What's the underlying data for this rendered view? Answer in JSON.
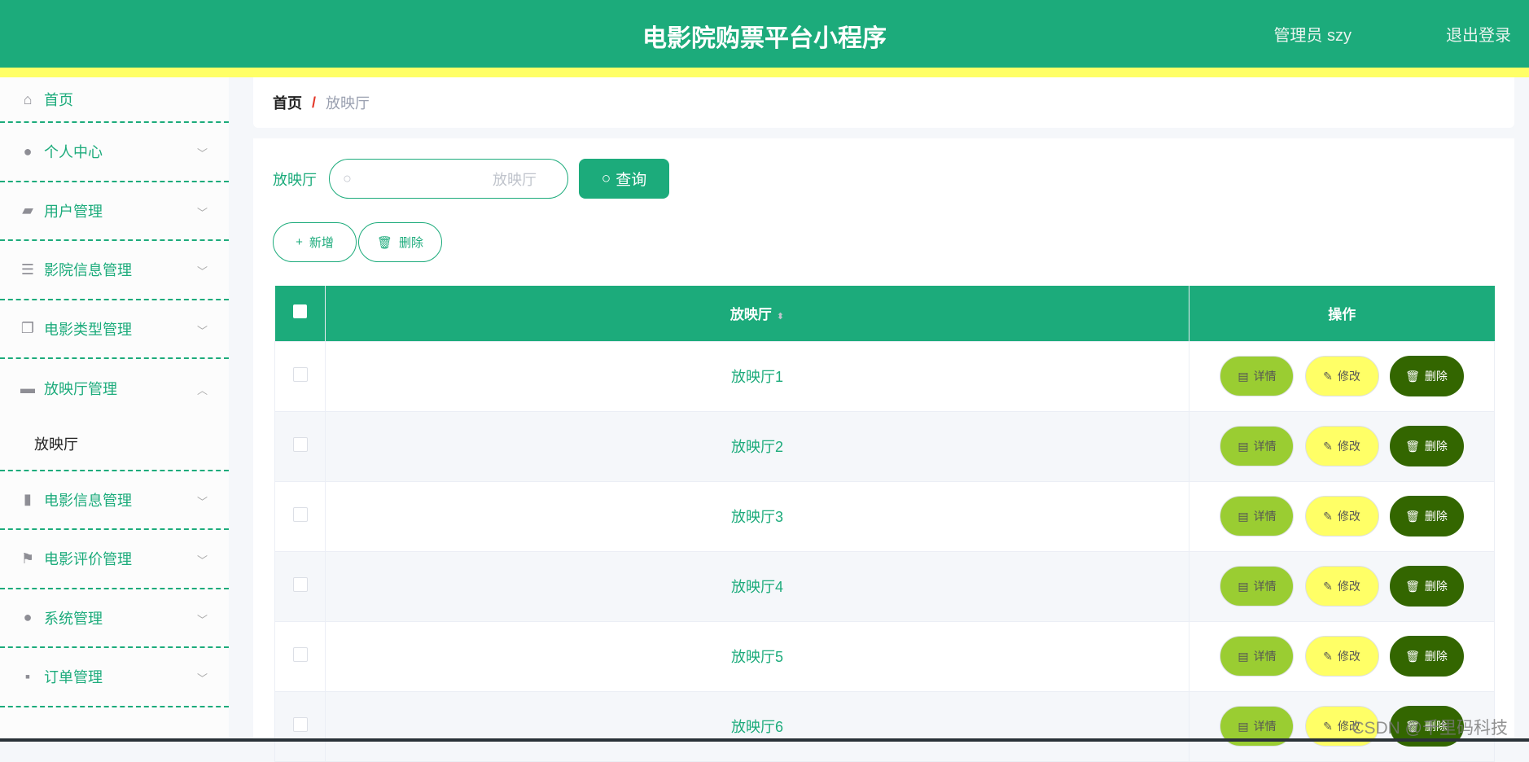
{
  "header": {
    "title": "电影院购票平台小程序",
    "user": "管理员 szy",
    "logout": "退出登录"
  },
  "sidebar": {
    "items": [
      {
        "label": "首页",
        "icon": "home-icon"
      },
      {
        "label": "个人中心",
        "icon": "user-icon"
      },
      {
        "label": "用户管理",
        "icon": "wallet-icon"
      },
      {
        "label": "影院信息管理",
        "icon": "list-icon"
      },
      {
        "label": "电影类型管理",
        "icon": "copy-icon"
      },
      {
        "label": "放映厅管理",
        "icon": "shop-icon",
        "expanded": true,
        "children": [
          "放映厅"
        ]
      },
      {
        "label": "电影信息管理",
        "icon": "bar-chart-icon"
      },
      {
        "label": "电影评价管理",
        "icon": "flag-icon"
      },
      {
        "label": "系统管理",
        "icon": "user-icon"
      },
      {
        "label": "订单管理",
        "icon": "message-icon"
      }
    ]
  },
  "breadcrumb": {
    "home": "首页",
    "sep": "/",
    "current": "放映厅"
  },
  "search": {
    "label": "放映厅",
    "placeholder": "放映厅",
    "button": "查询"
  },
  "actions": {
    "add": "新增",
    "delete": "删除"
  },
  "table": {
    "columns": [
      "放映厅",
      "操作"
    ],
    "rows": [
      "放映厅1",
      "放映厅2",
      "放映厅3",
      "放映厅4",
      "放映厅5",
      "放映厅6"
    ],
    "row_actions": {
      "detail": "详情",
      "edit": "修改",
      "delete": "删除"
    }
  },
  "watermark": "CSDN @千里码科技",
  "colors": {
    "primary": "#1cab7b",
    "accent_bar": "#ffff66",
    "detail": "#9acd32",
    "edit": "#ffff66",
    "delete": "#336600"
  }
}
